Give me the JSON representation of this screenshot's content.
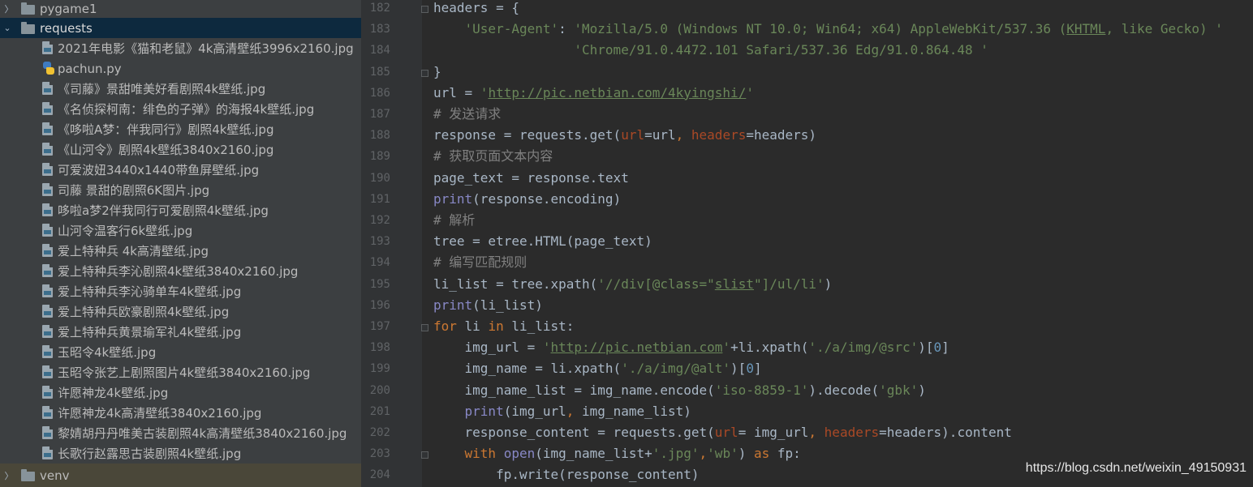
{
  "tree": {
    "folders": {
      "pygame1": "pygame1",
      "requests": "requests",
      "venv": "venv"
    },
    "files": [
      {
        "name": "2021年电影《猫和老鼠》4k高清壁纸3996x2160.jpg",
        "icon": "image-file-icon"
      },
      {
        "name": "pachun.py",
        "icon": "python-file-icon"
      },
      {
        "name": "《司藤》景甜唯美好看剧照4k壁纸.jpg",
        "icon": "image-file-icon"
      },
      {
        "name": "《名侦探柯南：绯色的子弹》的海报4k壁纸.jpg",
        "icon": "image-file-icon"
      },
      {
        "name": "《哆啦A梦：伴我同行》剧照4k壁纸.jpg",
        "icon": "image-file-icon"
      },
      {
        "name": "《山河令》剧照4k壁纸3840x2160.jpg",
        "icon": "image-file-icon"
      },
      {
        "name": "可爱波妞3440x1440带鱼屏壁纸.jpg",
        "icon": "image-file-icon"
      },
      {
        "name": "司藤 景甜的剧照6K图片.jpg",
        "icon": "image-file-icon"
      },
      {
        "name": "哆啦a梦2伴我同行可爱剧照4k壁纸.jpg",
        "icon": "image-file-icon"
      },
      {
        "name": "山河令温客行6k壁纸.jpg",
        "icon": "image-file-icon"
      },
      {
        "name": "爱上特种兵 4k高清壁纸.jpg",
        "icon": "image-file-icon"
      },
      {
        "name": "爱上特种兵李沁剧照4k壁纸3840x2160.jpg",
        "icon": "image-file-icon"
      },
      {
        "name": "爱上特种兵李沁骑单车4k壁纸.jpg",
        "icon": "image-file-icon"
      },
      {
        "name": "爱上特种兵欧豪剧照4k壁纸.jpg",
        "icon": "image-file-icon"
      },
      {
        "name": "爱上特种兵黄景瑜军礼4k壁纸.jpg",
        "icon": "image-file-icon"
      },
      {
        "name": "玉昭令4k壁纸.jpg",
        "icon": "image-file-icon"
      },
      {
        "name": "玉昭令张艺上剧照图片4k壁纸3840x2160.jpg",
        "icon": "image-file-icon"
      },
      {
        "name": "许愿神龙4k壁纸.jpg",
        "icon": "image-file-icon"
      },
      {
        "name": "许愿神龙4k高清壁纸3840x2160.jpg",
        "icon": "image-file-icon"
      },
      {
        "name": "黎婧胡丹丹唯美古装剧照4k高清壁纸3840x2160.jpg",
        "icon": "image-file-icon"
      },
      {
        "name": "长歌行赵露思古装剧照4k壁纸.jpg",
        "icon": "image-file-icon"
      }
    ]
  },
  "editor": {
    "line_numbers": [
      "182",
      "183",
      "184",
      "185",
      "186",
      "187",
      "188",
      "189",
      "190",
      "191",
      "192",
      "193",
      "194",
      "195",
      "196",
      "197",
      "198",
      "199",
      "200",
      "201",
      "202",
      "203",
      "204"
    ],
    "lines": [
      "headers = {",
      "    'User-Agent': 'Mozilla/5.0 (Windows NT 10.0; Win64; x64) AppleWebKit/537.36 (KHTML, like Gecko) '",
      "                  'Chrome/91.0.4472.101 Safari/537.36 Edg/91.0.864.48 '",
      "}",
      "url = 'http://pic.netbian.com/4kyingshi/'",
      "# 发送请求",
      "response = requests.get(url=url, headers=headers)",
      "# 获取页面文本内容",
      "page_text = response.text",
      "print(response.encoding)",
      "# 解析",
      "tree = etree.HTML(page_text)",
      "# 编写匹配规则",
      "li_list = tree.xpath('//div[@class=\"slist\"]/ul/li')",
      "print(li_list)",
      "for li in li_list:",
      "    img_url = 'http://pic.netbian.com'+li.xpath('./a/img/@src')[0]",
      "    img_name = li.xpath('./a/img/@alt')[0]",
      "    img_name_list = img_name.encode('iso-8859-1').decode('gbk')",
      "    print(img_url, img_name_list)",
      "    response_content = requests.get(url= img_url, headers=headers).content",
      "    with open(img_name_list+'.jpg','wb') as fp:",
      "        fp.write(response_content)"
    ]
  },
  "watermark": "https://blog.csdn.net/weixin_49150931",
  "colors": {
    "keyword": "#cc7832",
    "string": "#6a8759",
    "comment": "#808080",
    "number": "#6897bb",
    "param": "#aa4926",
    "builtin": "#8888c6",
    "text": "#a9b7c6"
  }
}
